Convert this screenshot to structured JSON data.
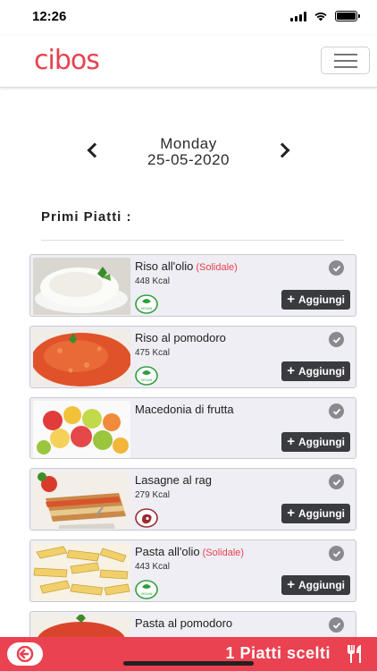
{
  "status": {
    "time": "12:26"
  },
  "header": {
    "logo": "cibos",
    "menu_icon": "hamburger-icon"
  },
  "date_nav": {
    "day": "Monday",
    "date": "25-05-2020"
  },
  "section": {
    "title": "Primi Piatti :"
  },
  "dishes": [
    {
      "name": "Riso all'olio",
      "tag": "(Solidale)",
      "kcal": "448 Kcal",
      "diet": "VEGAN",
      "button": "Aggiungi",
      "image": "plain rice"
    },
    {
      "name": "Riso al pomodoro",
      "tag": "",
      "kcal": "475 Kcal",
      "diet": "VEGAN",
      "button": "Aggiungi",
      "image": "tomato rice"
    },
    {
      "name": "Macedonia di frutta",
      "tag": "",
      "kcal": "",
      "diet": "",
      "button": "Aggiungi",
      "image": "fruit salad"
    },
    {
      "name": "Lasagne al rag",
      "tag": "",
      "kcal": "279 Kcal",
      "diet": "meat",
      "button": "Aggiungi",
      "image": "lasagne"
    },
    {
      "name": "Pasta all'olio",
      "tag": "(Solidale)",
      "kcal": "443 Kcal",
      "diet": "VEGAN",
      "button": "Aggiungi",
      "image": "penne"
    },
    {
      "name": "Pasta al pomodoro",
      "tag": "",
      "kcal": "",
      "diet": "",
      "button": "",
      "image": "tomato pasta"
    }
  ],
  "footer": {
    "count_text": "1 Piatti scelti"
  },
  "colors": {
    "brand_red": "#ea4251",
    "button_dark": "#3a3b3e",
    "card_bg": "#eeeef4",
    "vegan_green": "#2e9e3a",
    "meat_red": "#9b2a2f"
  }
}
